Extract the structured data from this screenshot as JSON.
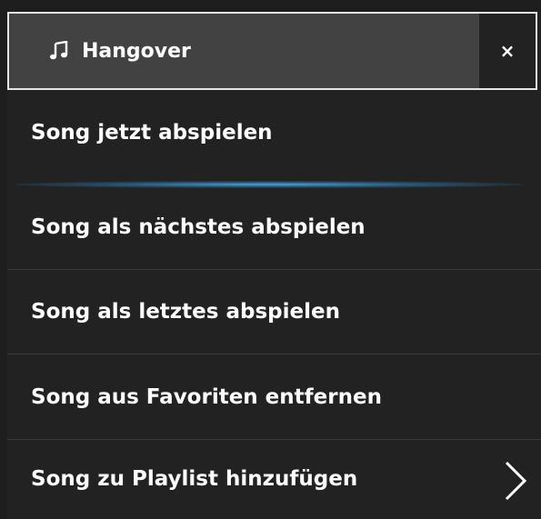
{
  "menu": {
    "title": "Hangover",
    "close_label": "×",
    "title_icon": "music-note-icon",
    "items": [
      {
        "label": "Song jetzt abspielen"
      },
      {
        "label": "Song als nächstes abspielen"
      },
      {
        "label": "Song als letztes abspielen"
      },
      {
        "label": "Song aus Favoriten entfernen"
      },
      {
        "label": "Song zu Playlist hinzufügen",
        "submenu_icon": "chevron-right-icon"
      }
    ]
  },
  "colors": {
    "header_bg": "#424242",
    "menu_bg": "#222222",
    "text": "#ffffff",
    "active_glow": "#50aadc"
  }
}
